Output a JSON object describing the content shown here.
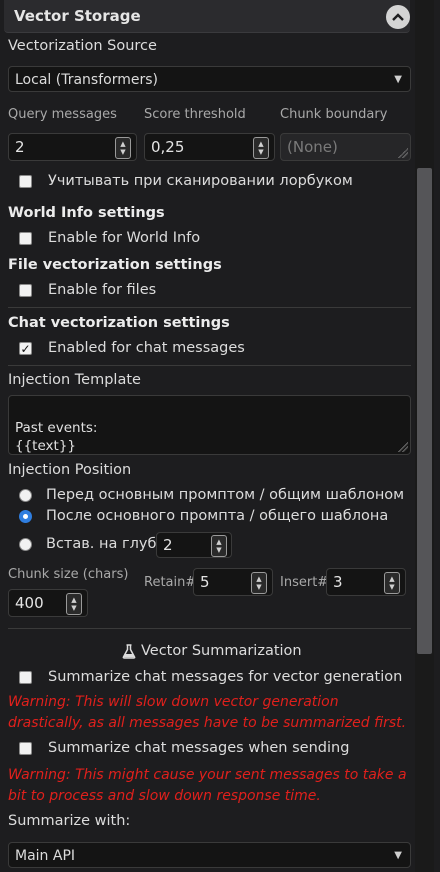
{
  "header": {
    "title": "Vector Storage"
  },
  "source": {
    "label": "Vectorization Source",
    "value": "Local (Transformers)"
  },
  "query": {
    "query_label": "Query messages",
    "query_value": "2",
    "score_label": "Score threshold",
    "score_value": "0,25",
    "chunk_label": "Chunk boundary",
    "chunk_placeholder": "(None)"
  },
  "lorebook": {
    "label": "Учитывать при сканировании лорбуком",
    "checked": false
  },
  "world_info": {
    "heading": "World Info settings",
    "label": "Enable for World Info",
    "checked": false
  },
  "files": {
    "heading": "File vectorization settings",
    "label": "Enable for files",
    "checked": false
  },
  "chat": {
    "heading": "Chat vectorization settings",
    "label": "Enabled for chat messages",
    "checked": true
  },
  "template": {
    "label": "Injection Template",
    "value": "Past events:\n{{text}}"
  },
  "position": {
    "label": "Injection Position",
    "options": [
      {
        "label": "Перед основным промптом / общим шаблоном",
        "selected": false
      },
      {
        "label": "После основного промпта / общего шаблона",
        "selected": true
      },
      {
        "label": "Встав. на глуб.",
        "selected": false
      }
    ],
    "depth_value": "2"
  },
  "chunk": {
    "size_label": "Chunk size (chars)",
    "size_value": "400",
    "retain_label": "Retain#",
    "retain_value": "5",
    "insert_label": "Insert#",
    "insert_value": "3"
  },
  "summarization": {
    "heading": "Vector Summarization",
    "generation_label": "Summarize chat messages for vector generation",
    "generation_warning": "Warning: This will slow down vector generation drastically, as all messages have to be summarized first.",
    "sending_label": "Summarize chat messages when sending",
    "sending_warning": "Warning: This might cause your sent messages to take a bit to process and slow down response time.",
    "with_label": "Summarize with:",
    "with_value": "Main API"
  },
  "colors": {
    "accent": "#2f7ee0",
    "warning": "#e0201c",
    "background": "#1d1d1f"
  }
}
